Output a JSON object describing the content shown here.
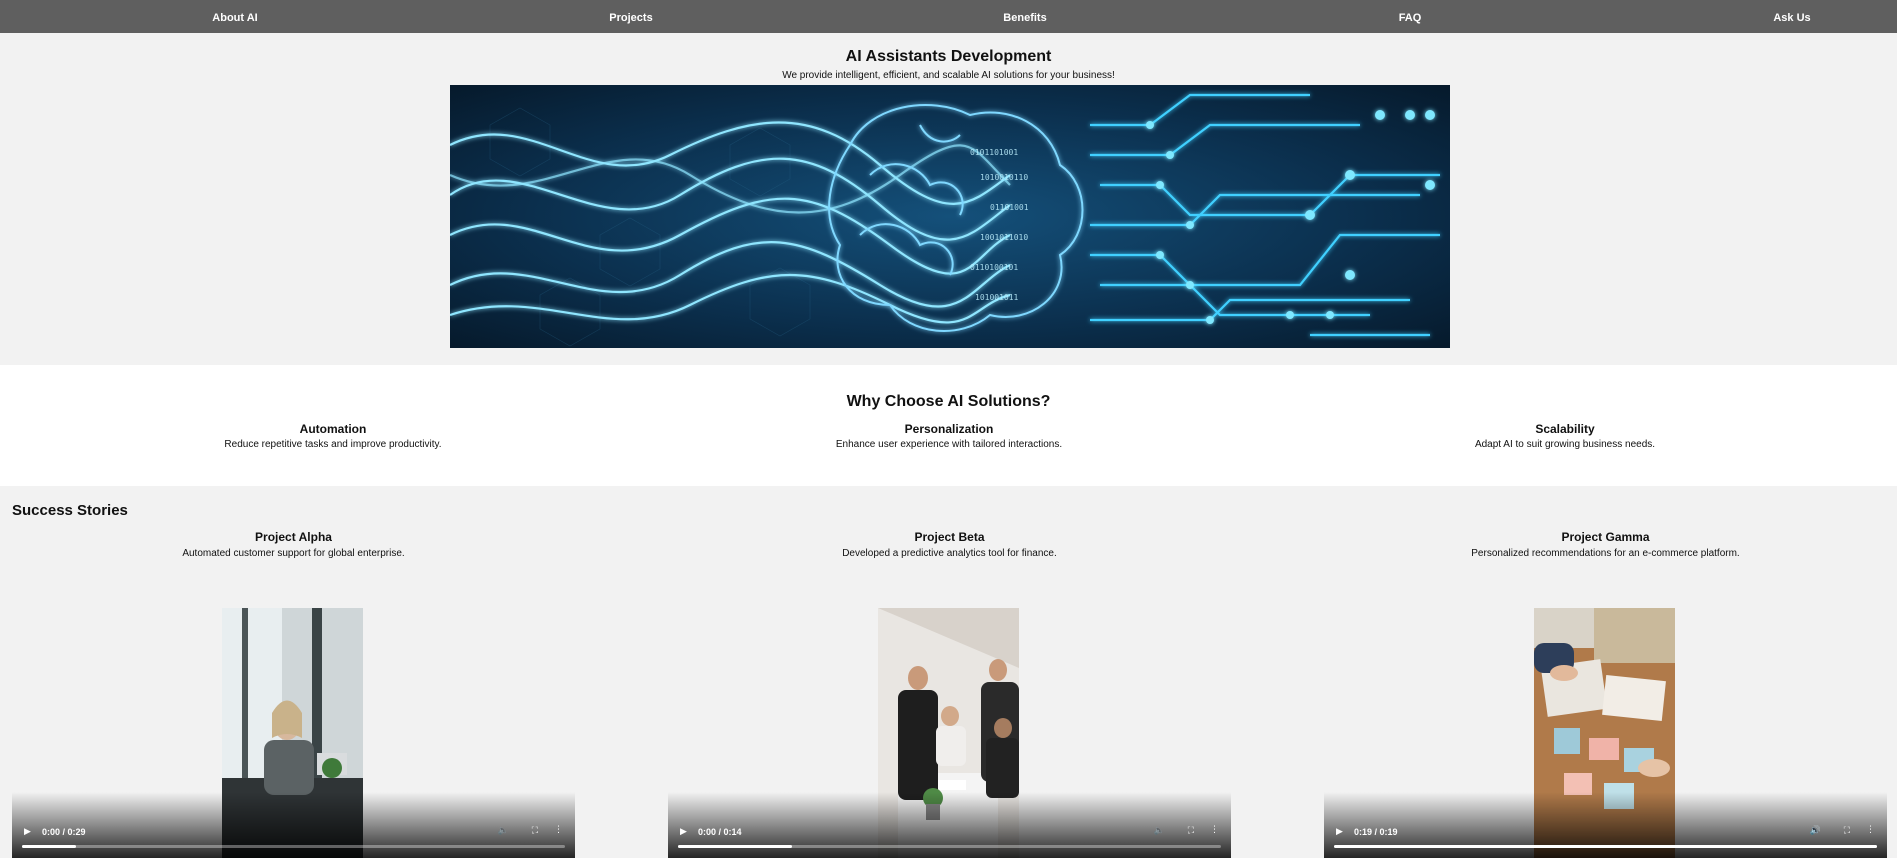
{
  "nav": {
    "items": [
      {
        "label": "About AI"
      },
      {
        "label": "Projects"
      },
      {
        "label": "Benefits"
      },
      {
        "label": "FAQ"
      },
      {
        "label": "Ask Us"
      }
    ]
  },
  "hero": {
    "title": "AI Assistants Development",
    "subtitle": "We provide intelligent, efficient, and scalable AI solutions for your business!"
  },
  "why": {
    "title": "Why Choose AI Solutions?",
    "features": [
      {
        "title": "Automation",
        "text": "Reduce repetitive tasks and improve productivity."
      },
      {
        "title": "Personalization",
        "text": "Enhance user experience with tailored interactions."
      },
      {
        "title": "Scalability",
        "text": "Adapt AI to suit growing business needs."
      }
    ]
  },
  "stories": {
    "title": "Success Stories",
    "items": [
      {
        "title": "Project Alpha",
        "text": "Automated customer support for global enterprise.",
        "time": "0:00 / 0:29",
        "progress": 0.1
      },
      {
        "title": "Project Beta",
        "text": "Developed a predictive analytics tool for finance.",
        "time": "0:00 / 0:14",
        "progress": 0.21
      },
      {
        "title": "Project Gamma",
        "text": "Personalized recommendations for an e-commerce platform.",
        "time": "0:19 / 0:19",
        "progress": 1.0
      }
    ]
  },
  "colors": {
    "nav_bg": "#5f5f5f",
    "page_bg": "#f2f2f2",
    "section_bg": "#ffffff",
    "hero_accent": "#3fd0ff"
  }
}
